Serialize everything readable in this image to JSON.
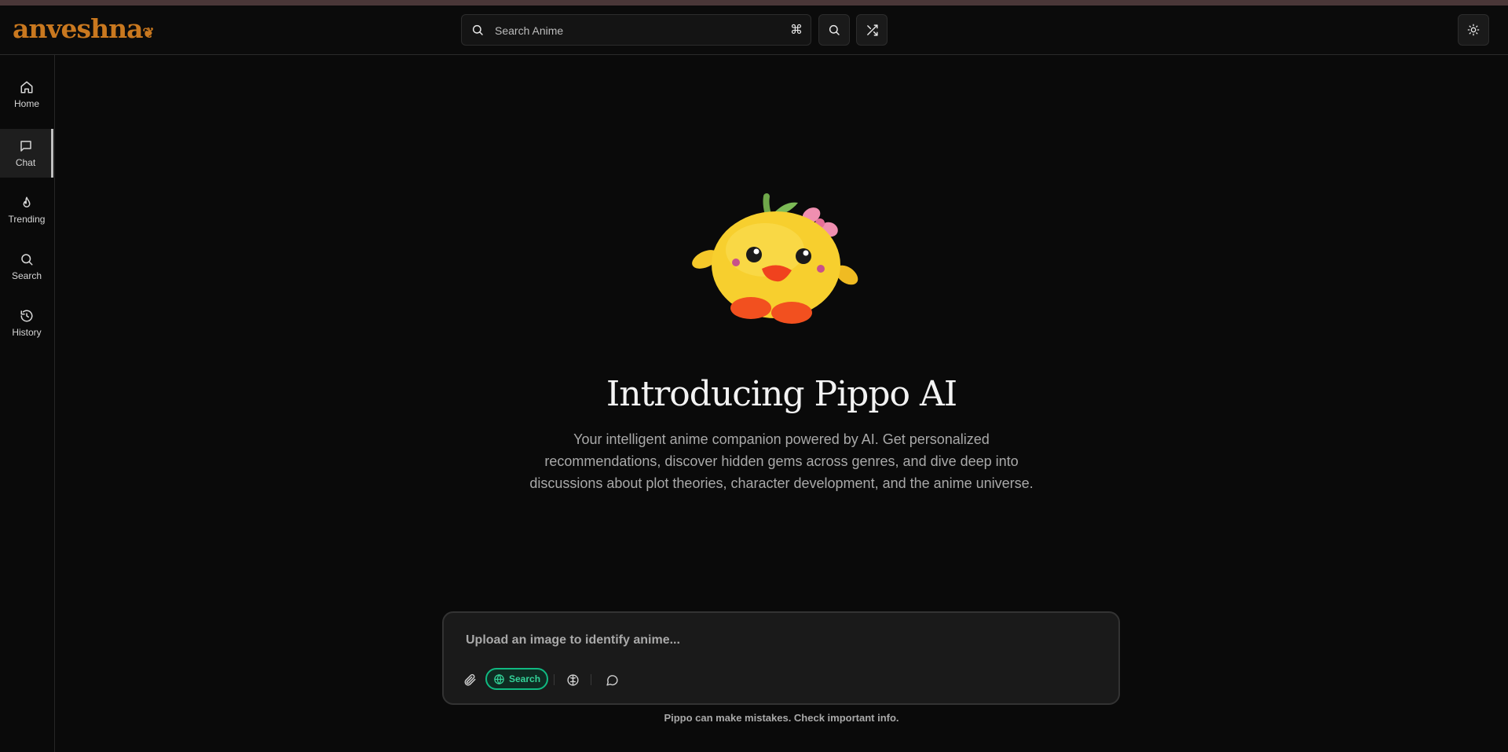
{
  "app": {
    "logo_text": "anveshna"
  },
  "header": {
    "search_placeholder": "Search Anime",
    "shortcut_glyph": "⌘",
    "icons": [
      "search-icon",
      "shuffle-icon",
      "sun-icon"
    ]
  },
  "sidebar": {
    "items": [
      {
        "label": "Home",
        "icon": "home-icon",
        "active": false
      },
      {
        "label": "Chat",
        "icon": "chat-icon",
        "active": true
      },
      {
        "label": "Trending",
        "icon": "flame-icon",
        "active": false
      },
      {
        "label": "Search",
        "icon": "search-icon",
        "active": false
      },
      {
        "label": "History",
        "icon": "history-icon",
        "active": false
      }
    ]
  },
  "hero": {
    "title": "Introducing Pippo AI",
    "description": "Your intelligent anime companion powered by AI. Get personalized recommendations, discover hidden gems across genres, and dive deep into discussions about plot theories, character development, and the anime universe."
  },
  "composer": {
    "placeholder": "Upload an image to identify anime...",
    "search_toggle_label": "Search",
    "tools": [
      "paperclip-icon",
      "globe-icon",
      "brain-icon",
      "message-circle-icon"
    ]
  },
  "footer": {
    "disclaimer": "Pippo can make mistakes. Check important info."
  },
  "colors": {
    "background": "#0a0a0a",
    "accent_green": "#10b981",
    "logo_orange": "#c9781f"
  }
}
